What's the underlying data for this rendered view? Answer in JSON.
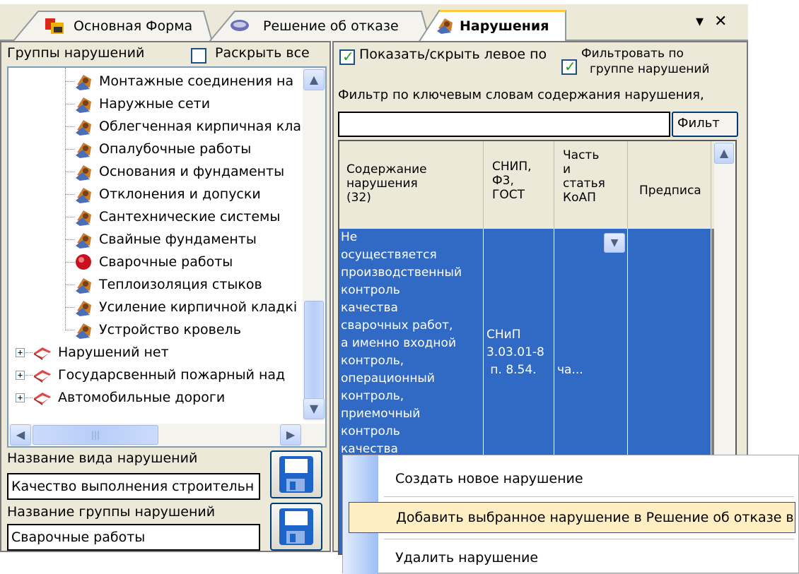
{
  "tabs": [
    {
      "label": "Основная Форма"
    },
    {
      "label": "Решение об отказе"
    },
    {
      "label": "Нарушения"
    }
  ],
  "window_controls": {
    "menu_glyph": "▾",
    "close_glyph": "✕"
  },
  "left": {
    "groups_label": "Группы нарушений",
    "expand_all_label": "Раскрыть все",
    "expand_all_checked": false,
    "tree_children": [
      "Монтажные соединения на",
      "Наружные сети",
      "Облегченная кирпичная кла",
      "Опалубочные работы",
      "Основания и фундаменты",
      "Отклонения и допуски",
      "Сантехнические системы",
      "Свайные фундаменты",
      "Сварочные работы",
      "Теплоизоляция стыков",
      "Усиление кирпичной кладкі",
      "Устройство кровель"
    ],
    "selected_child_index": 8,
    "tree_roots": [
      "Нарушений нет",
      "Государсвенный пожарный над",
      "Автомобильные дороги"
    ],
    "hscroll_thumb_glyph": "|||",
    "violation_type_label": "Название вида нарушений",
    "violation_type_value": "Качество выполнения строительн",
    "violation_group_label": "Название группы нарушений",
    "violation_group_value": "Сварочные работы"
  },
  "right": {
    "show_hide_label": "Показать/скрыть левое по",
    "show_hide_checked": true,
    "filter_by_group_label_1": "Фильтровать по",
    "filter_by_group_label_2": "группе нарушений",
    "filter_by_group_checked": true,
    "keyword_filter_label": "Фильтр по ключевым словам содержания нарушения,",
    "keyword_filter_value": "",
    "filter_button_label": "Фильт",
    "columns": [
      {
        "lines": [
          "Содержание",
          "нарушения",
          "(32)"
        ]
      },
      {
        "lines": [
          "СНИП,",
          "Ф3,",
          "ГОСТ"
        ]
      },
      {
        "lines": [
          "Часть",
          "и",
          "статья",
          "КоАП"
        ]
      },
      {
        "lines": [
          "Предписа"
        ]
      }
    ],
    "row": {
      "content_lines": [
        "Не",
        "осуществяется",
        "производственный",
        "контроль",
        "качества",
        "сварочных работ,",
        "а именно входной",
        "контроль,",
        "операционный",
        "контроль,",
        "приемочный",
        "контроль",
        "качества"
      ],
      "snip_lines": [
        "СНиП",
        "3.03.01-8",
        " п. 8.54."
      ],
      "koap": "ча..."
    }
  },
  "context_menu": {
    "items": [
      "Создать новое нарушение",
      "Добавить выбранное нарушение в Решение об отказе в",
      "Удалить нарушение"
    ],
    "highlighted_index": 1
  }
}
